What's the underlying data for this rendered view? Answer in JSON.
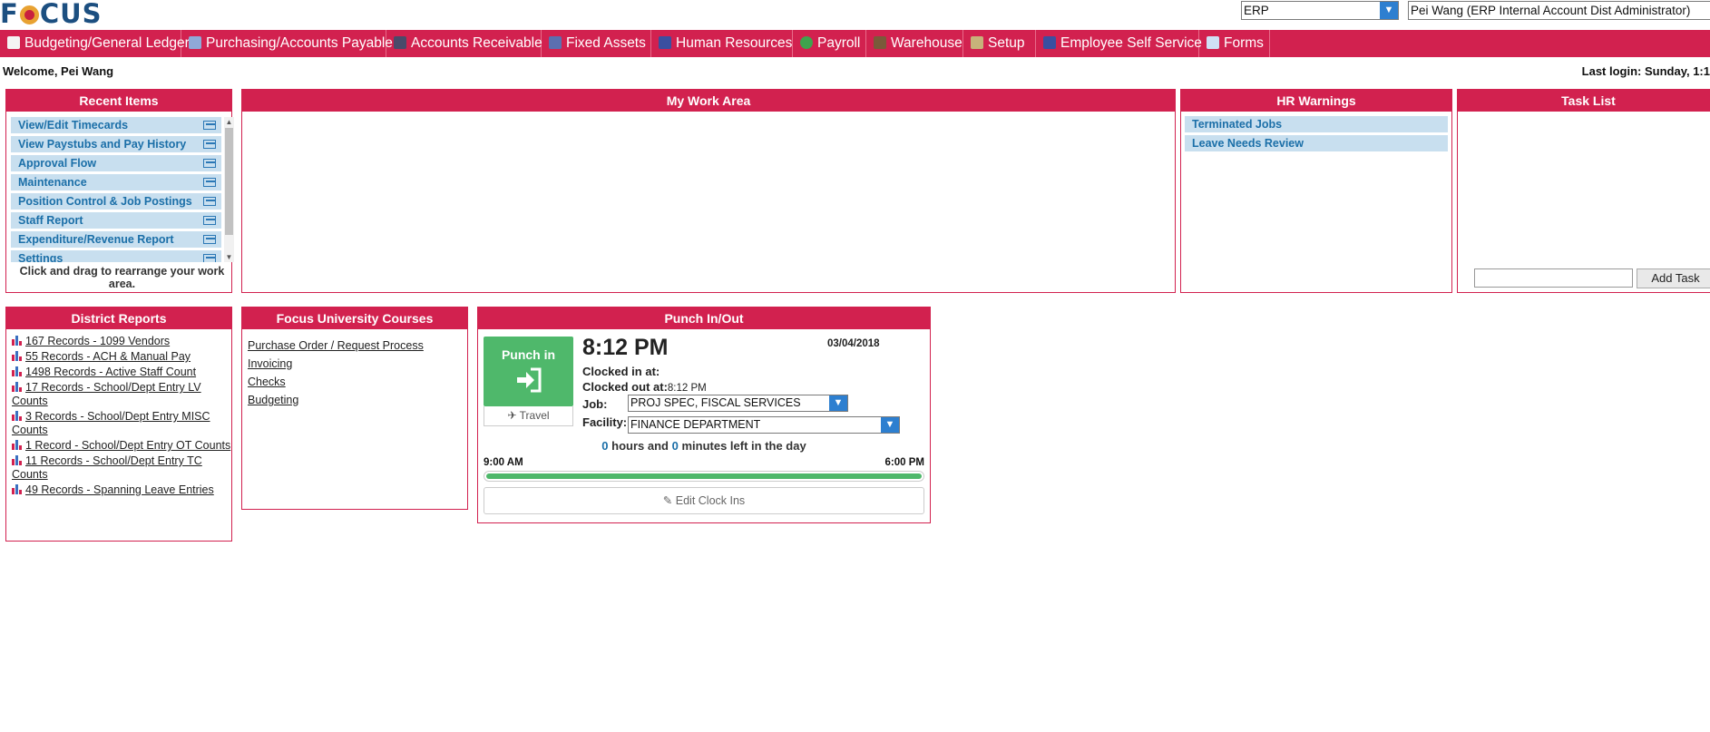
{
  "app": {
    "logo": "FOCUS"
  },
  "header": {
    "module_select": "ERP",
    "user_select": "Pei Wang (ERP Internal Account Dist Administrator)"
  },
  "nav": [
    {
      "label": "Budgeting/General Ledger",
      "icon": "ledger-icon"
    },
    {
      "label": "Purchasing/Accounts Payable",
      "icon": "cart-icon"
    },
    {
      "label": "Accounts Receivable",
      "icon": "receivable-icon"
    },
    {
      "label": "Fixed Assets",
      "icon": "building-icon"
    },
    {
      "label": "Human Resources",
      "icon": "people-icon"
    },
    {
      "label": "Payroll",
      "icon": "dollar-icon"
    },
    {
      "label": "Warehouse",
      "icon": "forklift-icon"
    },
    {
      "label": "Setup",
      "icon": "tools-icon"
    },
    {
      "label": "Employee Self Service",
      "icon": "people-icon"
    },
    {
      "label": "Forms",
      "icon": "form-icon"
    }
  ],
  "welcome": "Welcome, Pei Wang",
  "last_login": "Last login: Sunday, 1:1",
  "recent": {
    "title": "Recent Items",
    "items": [
      "View/Edit Timecards",
      "View Paystubs and Pay History",
      "Approval Flow",
      "Maintenance",
      "Position Control & Job Postings",
      "Staff Report",
      "Expenditure/Revenue Report",
      "Settings"
    ],
    "hint": "Click and drag to rearrange your work area."
  },
  "work_area": {
    "title": "My Work Area"
  },
  "hr_warnings": {
    "title": "HR Warnings",
    "items": [
      "Terminated Jobs",
      "Leave Needs Review"
    ]
  },
  "task_list": {
    "title": "Task List",
    "add_label": "Add Task",
    "input_value": ""
  },
  "district_reports": {
    "title": "District Reports",
    "items": [
      "167 Records - 1099 Vendors",
      "55 Records - ACH & Manual Pay",
      "1498 Records - Active Staff Count",
      "17 Records - School/Dept Entry LV Counts",
      "3 Records - School/Dept Entry MISC Counts",
      "1 Record - School/Dept Entry OT Counts",
      "11 Records - School/Dept Entry TC Counts",
      "49 Records - Spanning Leave Entries"
    ]
  },
  "courses": {
    "title": "Focus University Courses",
    "items": [
      "Purchase Order / Request Process",
      "Invoicing",
      "Checks",
      "Budgeting"
    ]
  },
  "punch": {
    "title": "Punch In/Out",
    "button_label": "Punch in",
    "travel_label": "Travel",
    "time": "8:12 PM",
    "date": "03/04/2018",
    "clocked_in_label": "Clocked in at:",
    "clocked_in_value": "",
    "clocked_out_label": "Clocked out at:",
    "clocked_out_value": "8:12 PM",
    "job_label": "Job:",
    "job_value": "PROJ SPEC, FISCAL SERVICES",
    "facility_label": "Facility:",
    "facility_value": "FINANCE DEPARTMENT",
    "hours_left": "0",
    "hours_text": "hours and",
    "minutes_left": "0",
    "minutes_text": "minutes left in the day",
    "start_time": "9:00 AM",
    "end_time": "6:00 PM",
    "progress_fraction": 1.0,
    "edit_label": "Edit Clock Ins"
  },
  "colors": {
    "brand": "#d2214f",
    "link": "#1b6fa8",
    "accent_green": "#4fb86b",
    "select_blue": "#2d7fd0"
  }
}
